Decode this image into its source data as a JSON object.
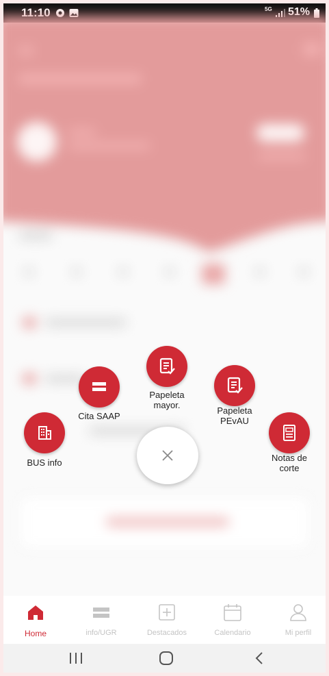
{
  "status_bar": {
    "time": "11:10",
    "network": "5G",
    "battery": "51%"
  },
  "speed_dial": {
    "actions": [
      {
        "label": "Papeleta\nmayor.",
        "icon": "document-check-icon"
      },
      {
        "label": "Cita SAAP",
        "icon": "card-icon"
      },
      {
        "label": "Papeleta\nPEvAU",
        "icon": "document-check-icon"
      },
      {
        "label": "BUS info",
        "icon": "building-icon"
      },
      {
        "label": "Notas de\ncorte",
        "icon": "certificate-icon"
      }
    ],
    "close_icon": "close-icon"
  },
  "bottom_nav": {
    "items": [
      {
        "label": "Home",
        "icon": "home-icon",
        "active": true
      },
      {
        "label": "info/UGR",
        "icon": "card-icon",
        "active": false
      },
      {
        "label": "Destacados",
        "icon": "plus-square-icon",
        "active": false
      },
      {
        "label": "Calendario",
        "icon": "calendar-icon",
        "active": false
      },
      {
        "label": "Mi perfil",
        "icon": "user-icon",
        "active": false
      }
    ]
  },
  "colors": {
    "accent": "#cf2a35",
    "header_bg": "#e39b9b",
    "inactive": "#c4c4c4"
  }
}
